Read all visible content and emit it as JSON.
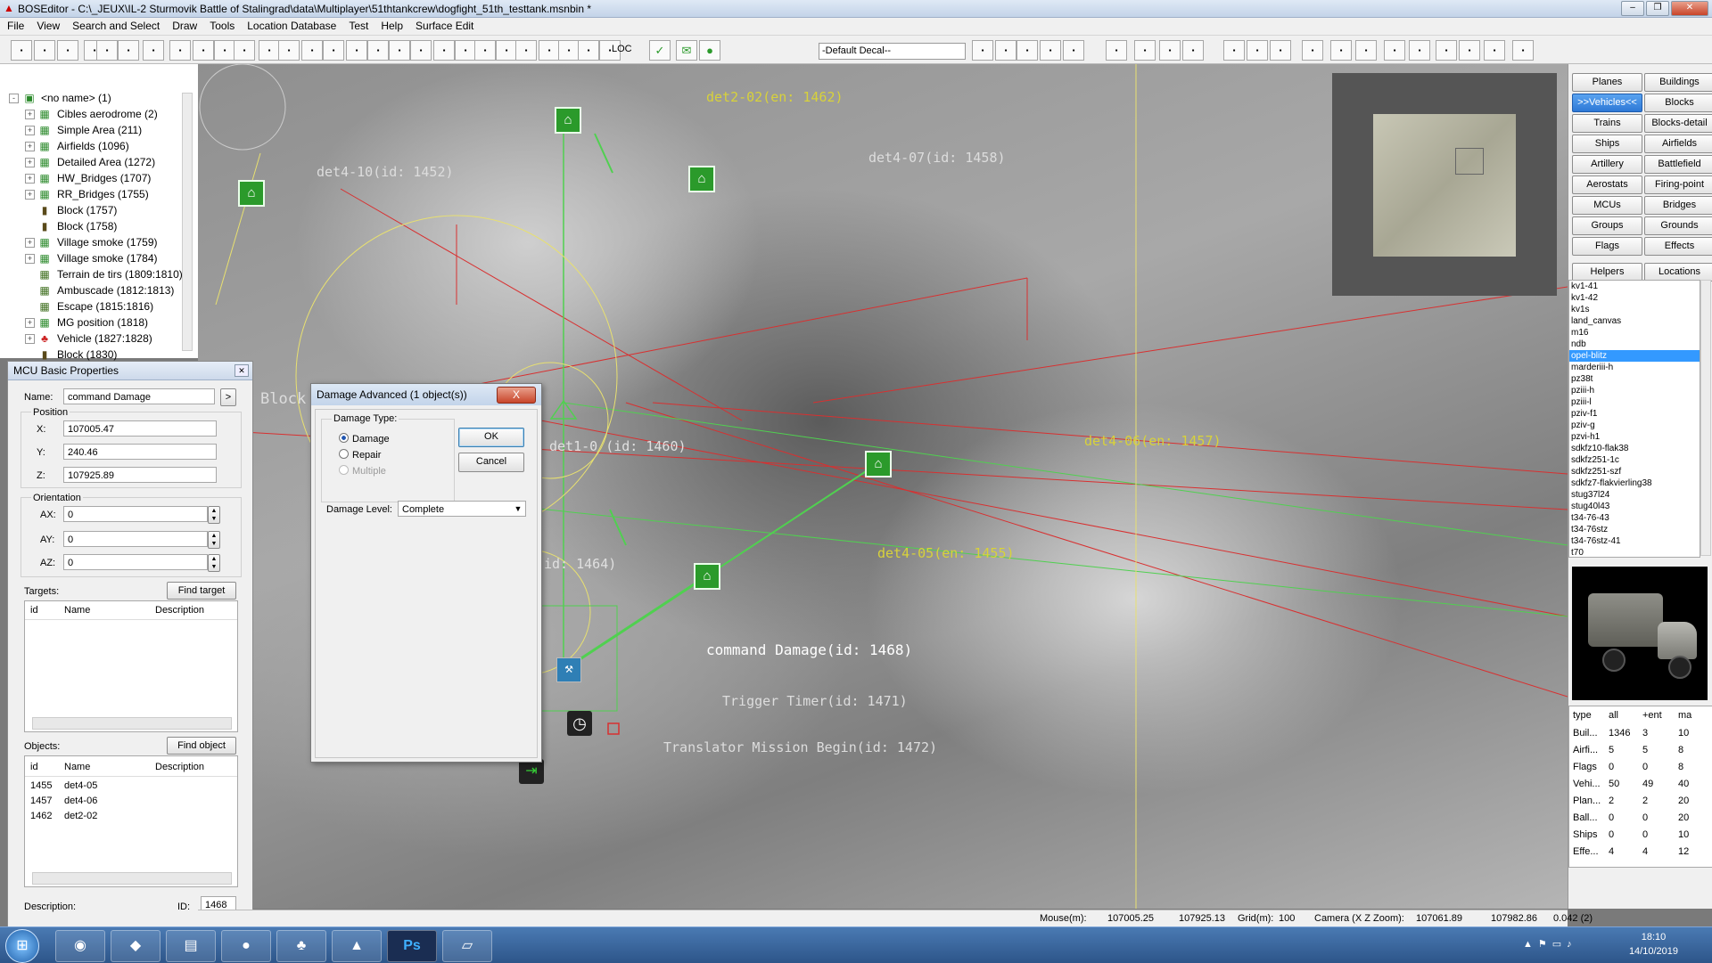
{
  "window": {
    "title": "BOSEditor - C:\\_JEUX\\IL-2 Sturmovik Battle of Stalingrad\\data\\Multiplayer\\51thtankcrew\\dogfight_51th_testtank.msnbin *"
  },
  "menu": [
    "File",
    "View",
    "Search and Select",
    "Draw",
    "Tools",
    "Location Database",
    "Test",
    "Help",
    "Surface Edit"
  ],
  "toolbar": {
    "decal": "-Default Decal--",
    "loc": "LOC"
  },
  "tree": [
    {
      "label": "<no name> (1)",
      "expand": "-",
      "icon": "root"
    },
    {
      "label": "Cibles aerodrome (2)",
      "expand": "+",
      "icon": "group"
    },
    {
      "label": "Simple Area (211)",
      "expand": "+",
      "icon": "group"
    },
    {
      "label": "Airfields (1096)",
      "expand": "+",
      "icon": "group"
    },
    {
      "label": "Detailed Area (1272)",
      "expand": "+",
      "icon": "group"
    },
    {
      "label": "HW_Bridges (1707)",
      "expand": "+",
      "icon": "group"
    },
    {
      "label": "RR_Bridges (1755)",
      "expand": "+",
      "icon": "group"
    },
    {
      "label": "Block (1757)",
      "expand": "",
      "icon": "block"
    },
    {
      "label": "Block (1758)",
      "expand": "",
      "icon": "block"
    },
    {
      "label": "Village smoke (1759)",
      "expand": "+",
      "icon": "group"
    },
    {
      "label": "Village smoke (1784)",
      "expand": "+",
      "icon": "group"
    },
    {
      "label": "Terrain de tirs (1809:1810)",
      "expand": "",
      "icon": "area"
    },
    {
      "label": "Ambuscade (1812:1813)",
      "expand": "",
      "icon": "area"
    },
    {
      "label": "Escape (1815:1816)",
      "expand": "",
      "icon": "area"
    },
    {
      "label": "MG position (1818)",
      "expand": "+",
      "icon": "group"
    },
    {
      "label": "Vehicle (1827:1828)",
      "expand": "+",
      "icon": "vehicle"
    },
    {
      "label": "Block (1830)",
      "expand": "",
      "icon": "block"
    }
  ],
  "mcu": {
    "title": "MCU Basic Properties",
    "name_label": "Name:",
    "name": "command Damage",
    "position_label": "Position",
    "x_label": "X:",
    "x": "107005.47",
    "y_label": "Y:",
    "y": "240.46",
    "z_label": "Z:",
    "z": "107925.89",
    "orientation_label": "Orientation",
    "ax_label": "AX:",
    "ax": "0",
    "ay_label": "AY:",
    "ay": "0",
    "az_label": "AZ:",
    "az": "0",
    "targets_label": "Targets:",
    "find_target": "Find target",
    "objects_label": "Objects:",
    "find_object": "Find object",
    "col_id": "id",
    "col_name": "Name",
    "col_desc": "Description",
    "objects": [
      {
        "id": "1455",
        "name": "det4-05"
      },
      {
        "id": "1457",
        "name": "det4-06"
      },
      {
        "id": "1462",
        "name": "det2-02"
      }
    ],
    "description_label": "Description:",
    "id_label": "ID:",
    "id": "1468"
  },
  "dialog": {
    "title": "Damage Advanced (1 object(s))",
    "close": "X",
    "damage_type_label": "Damage Type:",
    "opt_damage": "Damage",
    "opt_repair": "Repair",
    "opt_multiple": "Multiple",
    "damage_level_label": "Damage Level:",
    "damage_level": "Complete",
    "ok": "OK",
    "cancel": "Cancel"
  },
  "map_labels": {
    "det2_02": "det2-02(en: 1462)",
    "det4_10": "det4-10(id: 1452)",
    "det4_07": "det4-07(id: 1458)",
    "block": "Block",
    "det1_0": "det1-0 (id: 1460)",
    "det4_06": "det4-06(en: 1457)",
    "id1464": "id: 1464)",
    "det4_05": "det4-05(en: 1455)",
    "command_damage": "command Damage(id: 1468)",
    "trigger_timer": "Trigger Timer(id: 1471)",
    "translator": "Translator Mission Begin(id: 1472)"
  },
  "categories": [
    [
      "Planes",
      "Buildings"
    ],
    [
      ">>Vehicles<<",
      "Blocks"
    ],
    [
      "Trains",
      "Blocks-detail"
    ],
    [
      "Ships",
      "Airfields"
    ],
    [
      "Artillery",
      "Battlefield"
    ],
    [
      "Aerostats",
      "Firing-point"
    ],
    [
      "MCUs",
      "Bridges"
    ],
    [
      "Groups",
      "Grounds"
    ],
    [
      "Flags",
      "Effects"
    ],
    [
      "Helpers",
      "Locations"
    ]
  ],
  "vehicles": [
    "kv1-41",
    "kv1-42",
    "kv1s",
    "land_canvas",
    "m16",
    "ndb",
    "opel-blitz",
    "marderiii-h",
    "pz38t",
    "pziii-h",
    "pziii-l",
    "pziv-f1",
    "pziv-g",
    "pzvi-h1",
    "sdkfz10-flak38",
    "sdkfz251-1c",
    "sdkfz251-szf",
    "sdkfz7-flakvierling38",
    "stug37l24",
    "stug40l43",
    "t34-76-43",
    "t34-76stz",
    "t34-76stz-41",
    "t70"
  ],
  "selected_vehicle": "opel-blitz",
  "stats": {
    "headers": [
      "type",
      "all",
      "+ent",
      "ma"
    ],
    "rows": [
      [
        "Buil...",
        "1346",
        "3",
        "10"
      ],
      [
        "Airfi...",
        "5",
        "5",
        "8"
      ],
      [
        "Flags",
        "0",
        "0",
        "8"
      ],
      [
        "Vehi...",
        "50",
        "49",
        "40"
      ],
      [
        "Plan...",
        "2",
        "2",
        "20"
      ],
      [
        "Ball...",
        "0",
        "0",
        "20"
      ],
      [
        "Ships",
        "0",
        "0",
        "10"
      ],
      [
        "Effe...",
        "4",
        "4",
        "12"
      ]
    ]
  },
  "status": {
    "mouse_label": "Mouse(m):",
    "mouse_x": "107005.25",
    "mouse_z": "107925.13",
    "grid_label": "Grid(m):",
    "grid": "100",
    "camera_label": "Camera (X Z Zoom):",
    "cam_x": "107061.89",
    "cam_z": "107982.86",
    "zoom": "0.042 (2)"
  },
  "taskbar": {
    "time": "18:10",
    "date": "14/10/2019"
  },
  "colors": {
    "accent": "#3399ff",
    "map_green": "#2b9a2b",
    "line_red": "#d83030",
    "line_yellow": "#e8e070"
  }
}
